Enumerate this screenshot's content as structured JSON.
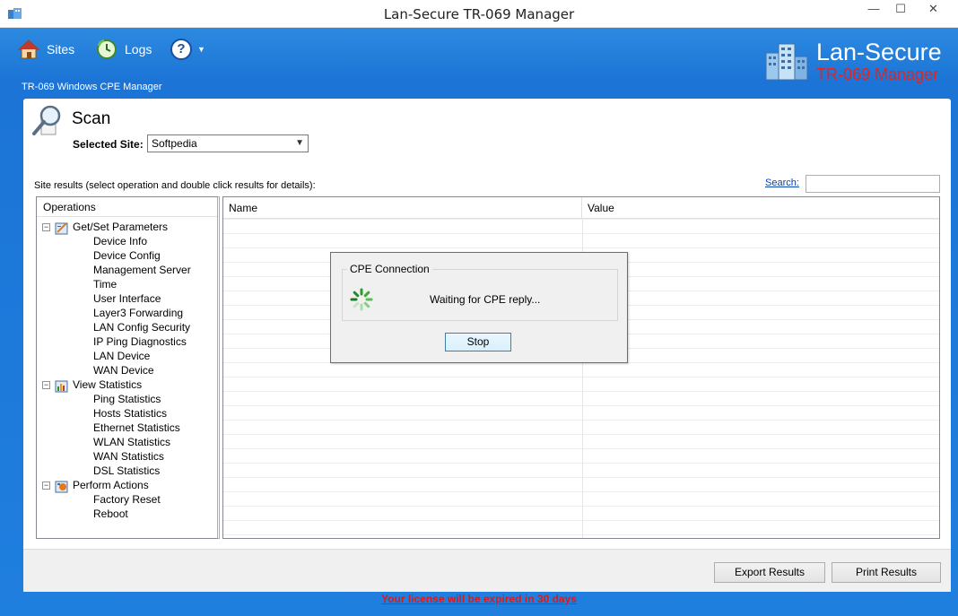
{
  "window": {
    "title": "Lan-Secure TR-069 Manager",
    "minimize": "—",
    "maximize": "☐",
    "close": "✕"
  },
  "nav": {
    "sites": "Sites",
    "logs": "Logs",
    "help": "?",
    "help_caret": "▼"
  },
  "header": {
    "subtitle": "TR-069 Windows CPE Manager",
    "brand_name": "Lan-Secure",
    "brand_product": "TR-069 Manager",
    "brand_product_color": "#e8221b"
  },
  "scan": {
    "title": "Scan",
    "site_label": "Selected Site:",
    "site_value": "Softpedia"
  },
  "results": {
    "label": "Site results (select operation and double click results for details):",
    "search_label": "Search:",
    "search_value": ""
  },
  "tree": {
    "header": "Operations",
    "groups": [
      {
        "label": "Get/Set Parameters",
        "toggle": "−",
        "icon": "parameters-icon",
        "items": [
          "Device Info",
          "Device Config",
          "Management Server",
          "Time",
          "User Interface",
          "Layer3 Forwarding",
          "LAN Config Security",
          "IP Ping Diagnostics",
          "LAN Device",
          "WAN Device"
        ]
      },
      {
        "label": "View Statistics",
        "toggle": "−",
        "icon": "statistics-icon",
        "items": [
          "Ping Statistics",
          "Hosts Statistics",
          "Ethernet Statistics",
          "WLAN Statistics",
          "WAN Statistics",
          "DSL Statistics"
        ]
      },
      {
        "label": "Perform Actions",
        "toggle": "−",
        "icon": "actions-icon",
        "items": [
          "Factory Reset",
          "Reboot"
        ]
      }
    ]
  },
  "grid": {
    "columns": [
      "Name",
      "Value"
    ]
  },
  "buttons": {
    "export": "Export Results",
    "print": "Print Results"
  },
  "license": "Your license will be expired in 30 days",
  "dialog": {
    "title": "CPE Connection",
    "message": "Waiting for CPE reply...",
    "stop": "Stop"
  },
  "colors": {
    "header_blue": "#1b74d6",
    "license_red": "#d81b1b"
  }
}
